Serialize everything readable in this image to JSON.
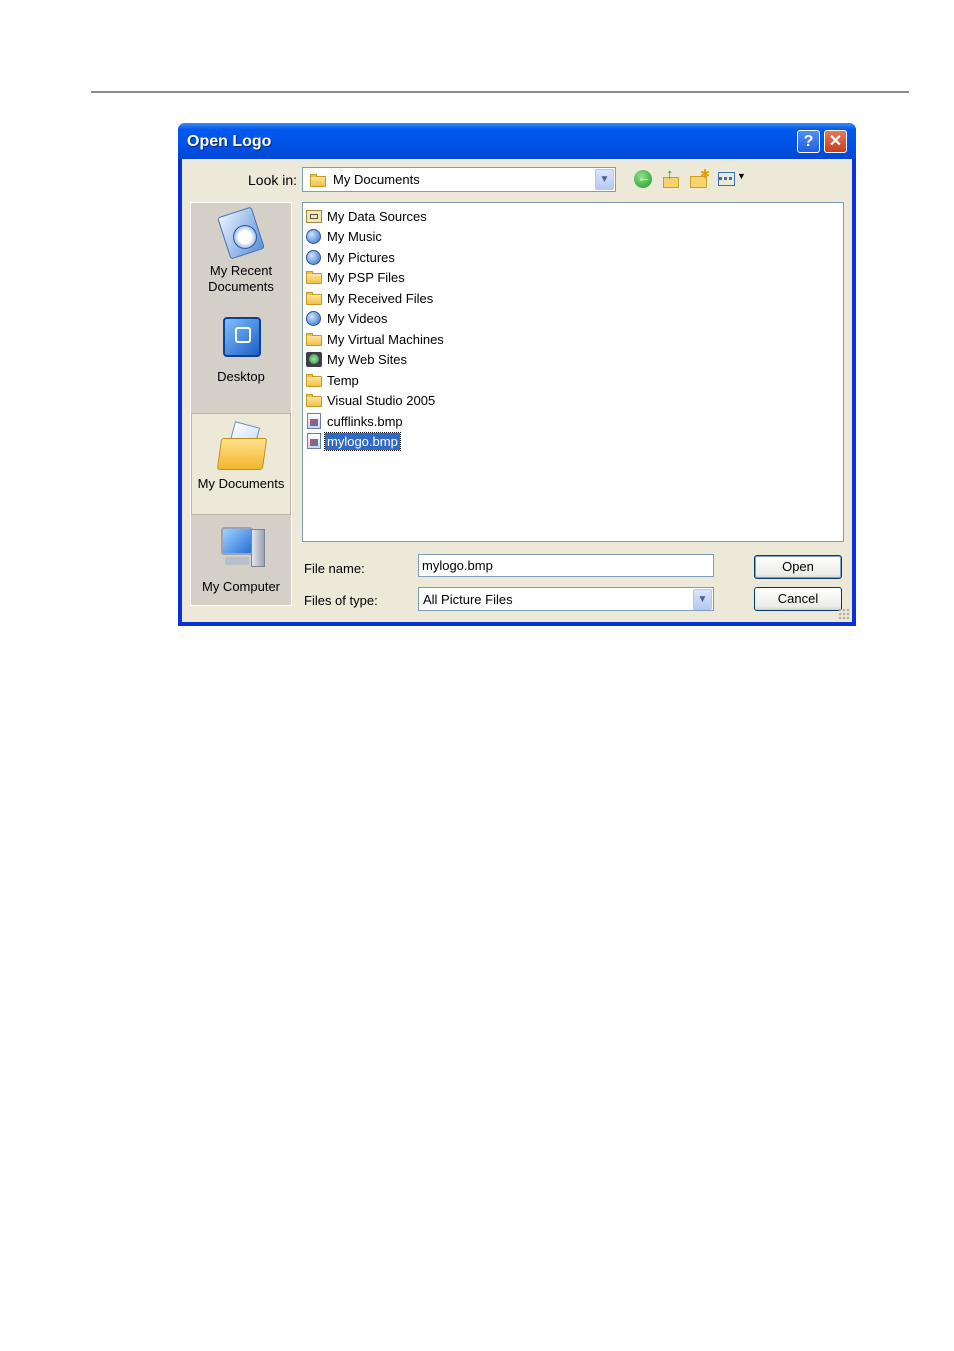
{
  "dialog": {
    "title": "Open Logo",
    "help_glyph": "?",
    "close_glyph": "✕"
  },
  "toolbar": {
    "lookin_label": "Look in:",
    "lookin_value": "My Documents",
    "icons": [
      "back-icon",
      "up-folder-icon",
      "new-folder-icon",
      "views-menu-icon"
    ]
  },
  "places": [
    {
      "label": "My Recent\nDocuments",
      "icon": "recent-documents-icon"
    },
    {
      "label": "Desktop",
      "icon": "desktop-icon"
    },
    {
      "label": "My Documents",
      "icon": "my-documents-icon",
      "selected": true
    },
    {
      "label": "My Computer",
      "icon": "my-computer-icon"
    }
  ],
  "files": [
    {
      "name": "My Data Sources",
      "icon": "data-sources-icon"
    },
    {
      "name": "My Music",
      "icon": "globe-folder-icon"
    },
    {
      "name": "My Pictures",
      "icon": "globe-folder-icon"
    },
    {
      "name": "My PSP Files",
      "icon": "folder-icon"
    },
    {
      "name": "My Received Files",
      "icon": "folder-icon"
    },
    {
      "name": "My Videos",
      "icon": "globe-folder-icon"
    },
    {
      "name": "My Virtual Machines",
      "icon": "folder-icon"
    },
    {
      "name": "My Web Sites",
      "icon": "web-sites-icon"
    },
    {
      "name": "Temp",
      "icon": "folder-icon"
    },
    {
      "name": "Visual Studio 2005",
      "icon": "folder-icon"
    },
    {
      "name": "cufflinks.bmp",
      "icon": "bitmap-file-icon"
    },
    {
      "name": "mylogo.bmp",
      "icon": "bitmap-file-icon",
      "selected": true
    }
  ],
  "fields": {
    "file_name_label": "File name:",
    "file_name_value": "mylogo.bmp",
    "file_type_label": "Files of type:",
    "file_type_value": "All Picture Files"
  },
  "buttons": {
    "open": "Open",
    "cancel": "Cancel"
  },
  "colors": {
    "title_bar": "#0058ee",
    "selection": "#316ac5",
    "dialog_face": "#ece9d8"
  }
}
